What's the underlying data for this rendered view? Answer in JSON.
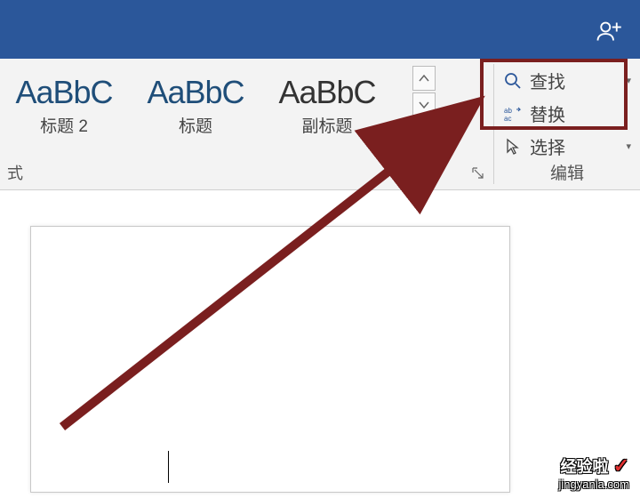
{
  "ribbon": {
    "styles": {
      "preview": "AaBbC",
      "items": [
        {
          "label": "标题 2"
        },
        {
          "label": "标题"
        },
        {
          "label": "副标题"
        }
      ],
      "group_suffix": "式"
    },
    "edit": {
      "find": "查找",
      "replace": "替换",
      "select": "选择",
      "group_label": "编辑"
    }
  },
  "watermark": {
    "brand": "经验啦",
    "url": "jingyanla.com"
  }
}
